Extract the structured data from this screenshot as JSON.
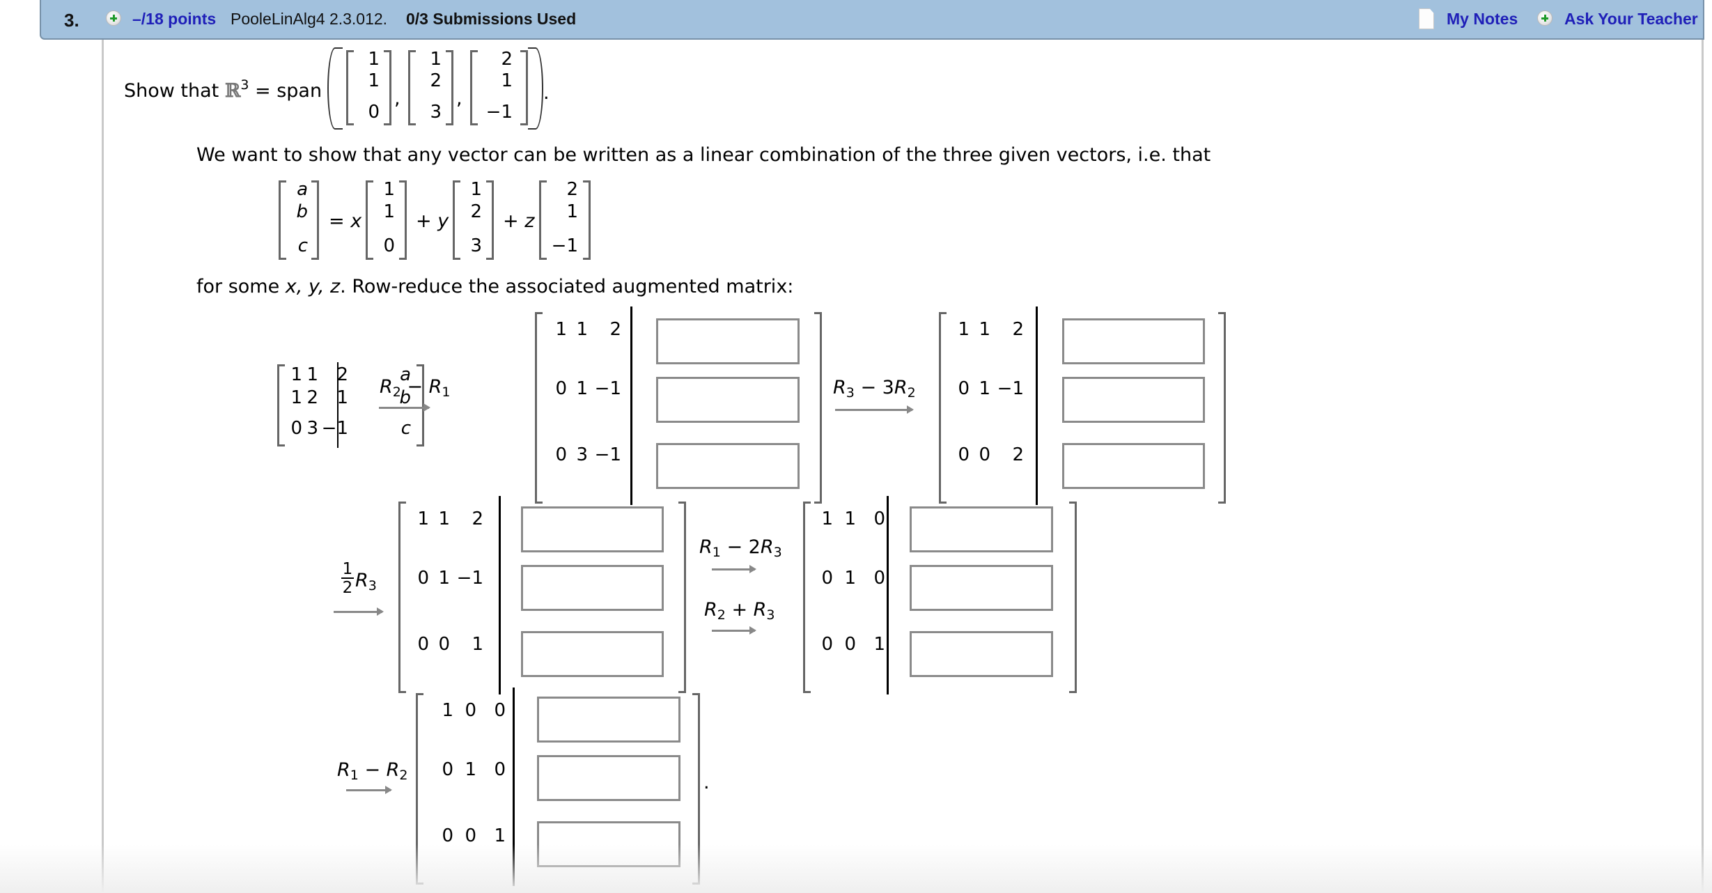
{
  "header": {
    "question_number": "3.",
    "points": "–/18 points",
    "problem_code": "PooleLinAlg4 2.3.012.",
    "submissions": "0/3 Submissions Used",
    "my_notes_label": "My Notes",
    "ask_teacher_label": "Ask Your Teacher"
  },
  "colors": {
    "header_bg": "#a2c1dd",
    "link": "#1f1fb8",
    "plus_icon": "#1f9a2a"
  },
  "problem": {
    "intro_prefix": "Show that",
    "space_symbol": "ℝ",
    "space_exp": "3",
    "equals_span": "= span",
    "span_vectors": [
      [
        "1",
        "1",
        "0"
      ],
      [
        "1",
        "2",
        "3"
      ],
      [
        "2",
        "1",
        "−1"
      ]
    ],
    "comma": ",",
    "period": ".",
    "statement": "We want to show that any vector can be written as a linear combination of the three given vectors, i.e. that",
    "lhs_vector": [
      "a",
      "b",
      "c"
    ],
    "eq_x": "= x",
    "plus_y": "+ y",
    "plus_z": "+ z",
    "for_some_prefix": "for some ",
    "for_some_vars": "x, y, z",
    "for_some_suffix": ". Row-reduce the associated augmented matrix:"
  },
  "augmented": {
    "rows": [
      [
        "1",
        "1",
        "2"
      ],
      [
        "1",
        "2",
        "1"
      ],
      [
        "0",
        "3",
        "−1"
      ]
    ],
    "rhs": [
      "a",
      "b",
      "c"
    ]
  },
  "steps": [
    {
      "op": [
        "R₂ − R₁"
      ],
      "rows": [
        [
          "1",
          "1",
          "2"
        ],
        [
          "0",
          "1",
          "−1"
        ],
        [
          "0",
          "3",
          "−1"
        ]
      ],
      "answers": [
        "",
        "",
        ""
      ]
    },
    {
      "op": [
        "R₃ − 3R₂"
      ],
      "rows": [
        [
          "1",
          "1",
          "2"
        ],
        [
          "0",
          "1",
          "−1"
        ],
        [
          "0",
          "0",
          "2"
        ]
      ],
      "answers": [
        "",
        "",
        ""
      ]
    },
    {
      "op": [
        "½R₃"
      ],
      "frac_num": "1",
      "frac_den": "2",
      "frac_var": "R",
      "frac_sub": "3",
      "rows": [
        [
          "1",
          "1",
          "2"
        ],
        [
          "0",
          "1",
          "−1"
        ],
        [
          "0",
          "0",
          "1"
        ]
      ],
      "answers": [
        "",
        "",
        ""
      ]
    },
    {
      "op": [
        "R₁ − 2R₃",
        "R₂ + R₃"
      ],
      "rows": [
        [
          "1",
          "1",
          "0"
        ],
        [
          "0",
          "1",
          "0"
        ],
        [
          "0",
          "0",
          "1"
        ]
      ],
      "answers": [
        "",
        "",
        ""
      ]
    },
    {
      "op": [
        "R₁ − R₂"
      ],
      "rows": [
        [
          "1",
          "0",
          "0"
        ],
        [
          "0",
          "1",
          "0"
        ],
        [
          "0",
          "0",
          "1"
        ]
      ],
      "answers": [
        "",
        "",
        ""
      ]
    }
  ],
  "ops_display": {
    "s1": {
      "a": "R",
      "a_sub": "2",
      "mid": " − ",
      "b": "R",
      "b_sub": "1"
    },
    "s2": {
      "a": "R",
      "a_sub": "3",
      "mid": " − 3",
      "b": "R",
      "b_sub": "2"
    },
    "s4a": {
      "a": "R",
      "a_sub": "1",
      "mid": " − 2",
      "b": "R",
      "b_sub": "3"
    },
    "s4b": {
      "a": "R",
      "a_sub": "2",
      "mid": " + ",
      "b": "R",
      "b_sub": "3"
    },
    "s5": {
      "a": "R",
      "a_sub": "1",
      "mid": " − ",
      "b": "R",
      "b_sub": "2"
    }
  },
  "final_period": "."
}
